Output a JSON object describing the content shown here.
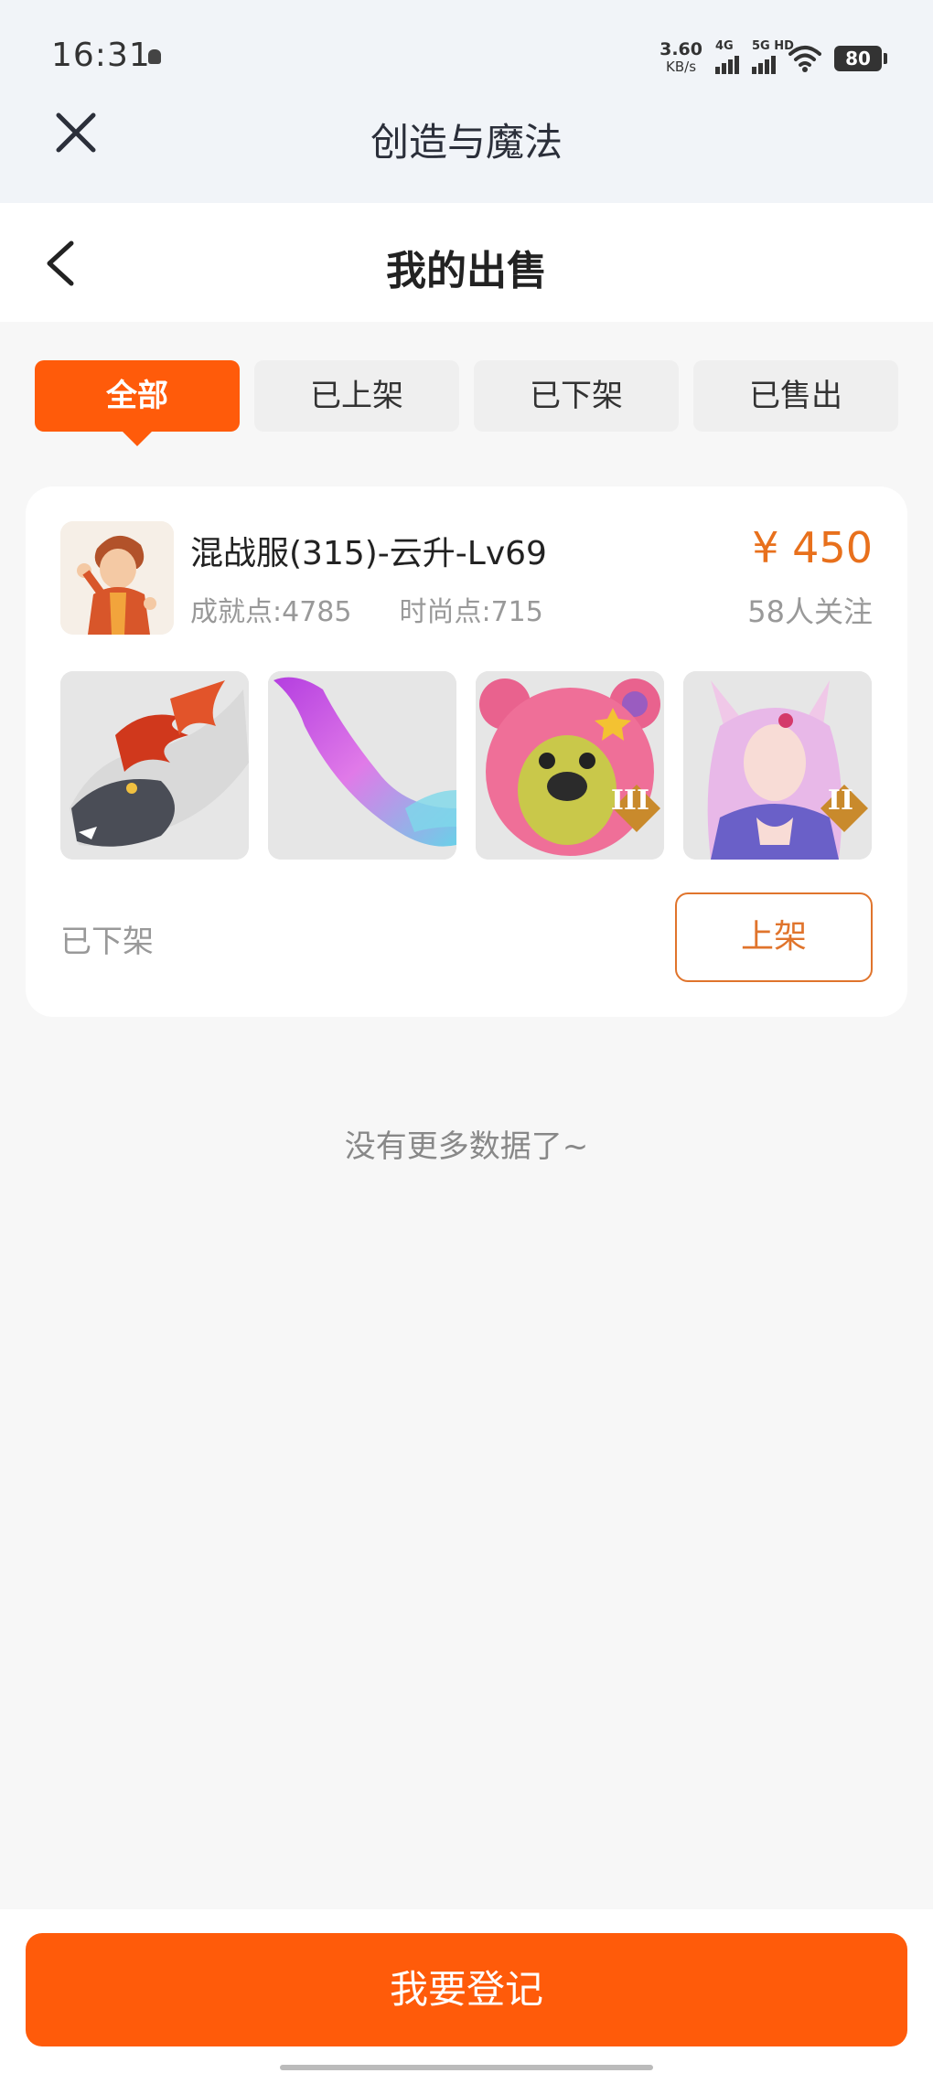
{
  "status_bar": {
    "time": "16:31",
    "speed_value": "3.60",
    "speed_unit": "KB/s",
    "net1": "4G",
    "net2": "5G HD",
    "battery": "80"
  },
  "title_bar": {
    "title": "创造与魔法",
    "close_icon": "close-icon"
  },
  "page_header": {
    "title": "我的出售",
    "back_icon": "chevron-left-icon"
  },
  "tabs": [
    {
      "label": "全部",
      "active": true
    },
    {
      "label": "已上架",
      "active": false
    },
    {
      "label": "已下架",
      "active": false
    },
    {
      "label": "已售出",
      "active": false
    }
  ],
  "listing": {
    "title": "混战服(315)-云升-Lv69",
    "achievement": "成就点:4785",
    "fashion": "时尚点:715",
    "price": "¥ 450",
    "followers": "58人关注",
    "status": "已下架",
    "action_label": "上架",
    "thumbnails": [
      {
        "name": "dragon-mount-image",
        "badge": ""
      },
      {
        "name": "fish-wing-image",
        "badge": ""
      },
      {
        "name": "pink-bear-image",
        "badge": "III"
      },
      {
        "name": "fox-girl-image",
        "badge": "II"
      }
    ]
  },
  "footer": {
    "no_more": "没有更多数据了~",
    "register_label": "我要登记"
  },
  "colors": {
    "accent": "#ff5b0a",
    "price": "#e8701c",
    "muted": "#999999"
  }
}
